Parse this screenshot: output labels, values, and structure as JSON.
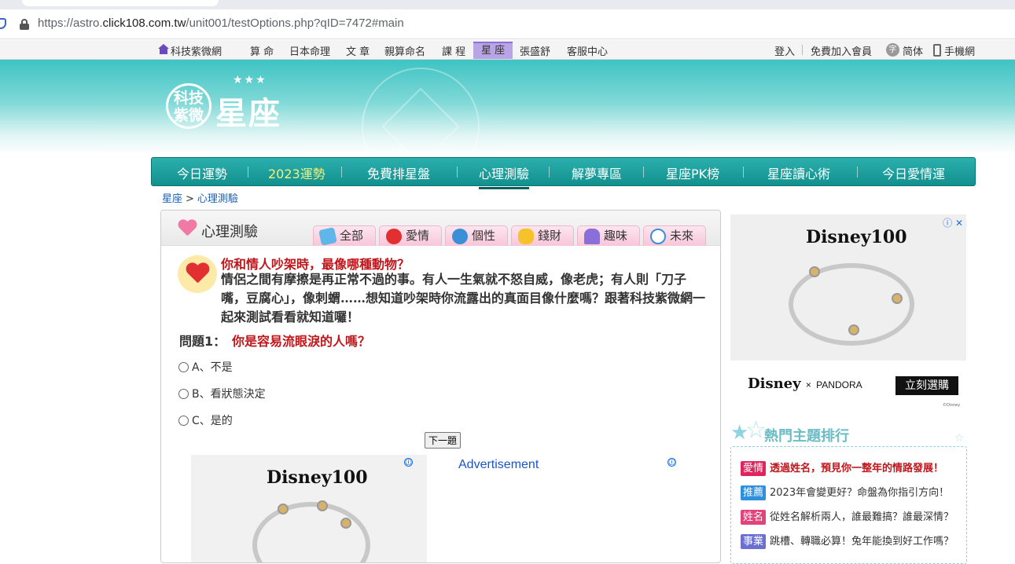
{
  "browser": {
    "url_prefix": "https://astro.",
    "url_domain": "click108.com.tw",
    "url_path": "/unit001/testOptions.php?qID=7472#main"
  },
  "topnav": {
    "home": "科技紫微網",
    "items": [
      "算 命",
      "日本命理",
      "文 章",
      "親算命名",
      "課 程",
      "星 座",
      "張盛舒",
      "客服中心"
    ],
    "login": "登入",
    "join": "免費加入會員",
    "lang": "简体",
    "lang_glyph": "字",
    "mobile": "手機網"
  },
  "banner": {
    "logo_circle_line1": "科技",
    "logo_circle_line2": "紫微",
    "logo_title": "星座",
    "stars": "★★★"
  },
  "mainnav": [
    "今日運勢",
    "2023運勢",
    "免費排星盤",
    "心理測驗",
    "解夢專區",
    "星座PK榜",
    "星座讀心術",
    "今日愛情運"
  ],
  "breadcrumb": {
    "home": "星座",
    "sep": ">",
    "current": "心理測驗"
  },
  "panel": {
    "title": "心理測驗",
    "tabs": [
      "全部",
      "愛情",
      "個性",
      "錢財",
      "趣味",
      "未來"
    ],
    "quiz_title": "你和情人吵架時，最像哪種動物？",
    "quiz_desc": "情侶之間有摩擦是再正常不過的事。有人一生氣就不怒自威，像老虎；有人則「刀子嘴，豆腐心」，像刺蝟……想知道吵架時你流露出的真面目像什麼嗎？跟著科技紫微網一起來測試看看就知道囉！",
    "question_label": "問題1：",
    "question": "你是容易流眼淚的人嗎？",
    "options": [
      "A、不是",
      "B、看狀態決定",
      "C、是的"
    ],
    "next_button": "下一題",
    "ad_label": "Advertisement",
    "ad_logo": "Disney100"
  },
  "sidebar": {
    "ad_logo": "Disney100",
    "ad_info": "ⓘ",
    "ad_close": "✕",
    "ad_brand_disney": "Disney",
    "ad_brand_x": "×",
    "ad_brand_pandora": "PANDORA",
    "ad_buy": "立刻選購",
    "ad_copyright": "©Disney",
    "hot_title": "熱門主題排行",
    "hot_items": [
      {
        "tag": "愛情",
        "color": "#e0245e",
        "text": "透過姓名，預見你一整年的情路發展！",
        "text_color": "#c0161b"
      },
      {
        "tag": "推薦",
        "color": "#2f8fdc",
        "text": "2023年會變更好？命盤為你指引方向！",
        "text_color": "#333333"
      },
      {
        "tag": "姓名",
        "color": "#e0447a",
        "text": "從姓名解析兩人，誰最難搞？誰最深情？",
        "text_color": "#333333"
      },
      {
        "tag": "事業",
        "color": "#6a6fd1",
        "text": "跳槽、轉職必算！兔年能換到好工作嗎？",
        "text_color": "#333333"
      }
    ]
  },
  "colors": {
    "accent_teal": "#11908e",
    "highlight_red": "#c0161b",
    "nav_active_purple": "#b9a4e6"
  }
}
